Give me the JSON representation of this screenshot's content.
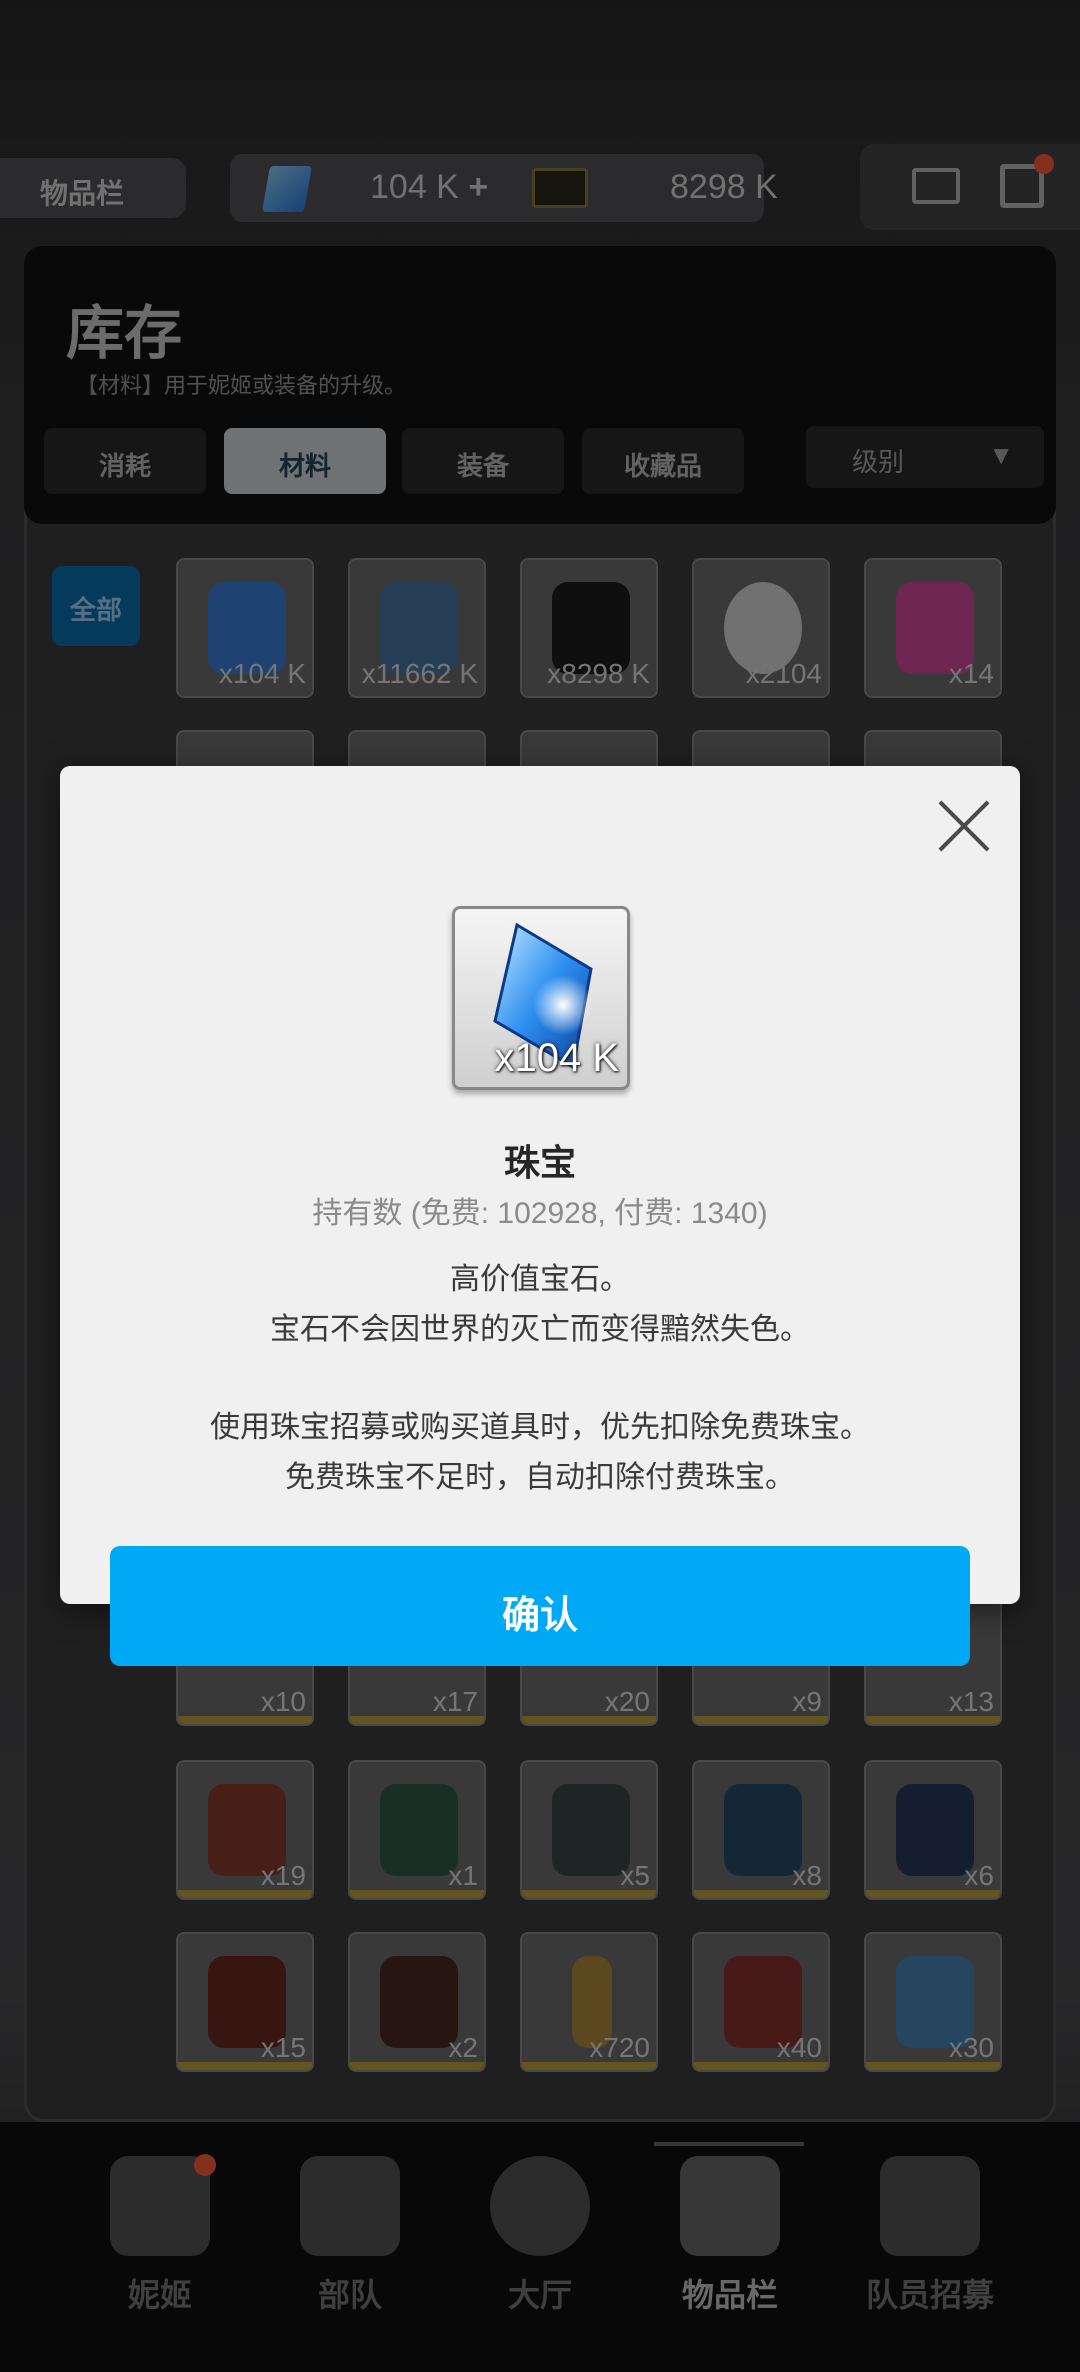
{
  "topbar": {
    "inventory_tag": "物品栏",
    "gems": "104 K",
    "plus": "+",
    "credits": "8298 K"
  },
  "inventory": {
    "title": "库存",
    "subtitle": "【材料】用于妮姬或装备的升级。",
    "tabs": [
      {
        "label": "消耗"
      },
      {
        "label": "材料"
      },
      {
        "label": "装备"
      },
      {
        "label": "收藏品"
      }
    ],
    "sort_label": "级别",
    "sort_arrow": "▼",
    "filter_all": "全部",
    "row1_counts": [
      "x104 K",
      "x11662 K",
      "x8298 K",
      "x2104",
      "x14"
    ],
    "row_a_counts": [
      "x10",
      "x17",
      "x20",
      "x9",
      "x13"
    ],
    "row_b_counts": [
      "x19",
      "x1",
      "x5",
      "x8",
      "x6"
    ],
    "row_c_counts": [
      "x15",
      "x2",
      "x720",
      "x40",
      "x30"
    ]
  },
  "nav": {
    "items": [
      {
        "label": "妮姬"
      },
      {
        "label": "部队"
      },
      {
        "label": "大厅"
      },
      {
        "label": "物品栏"
      },
      {
        "label": "队员招募"
      }
    ]
  },
  "modal": {
    "item_count": "x104 K",
    "item_name": "珠宝",
    "holding": "持有数 (免费: 102928, 付费: 1340)",
    "desc_line1": "高价值宝石。",
    "desc_line2": "宝石不会因世界的灭亡而变得黯然失色。",
    "desc_line3": "使用珠宝招募或购买道具时，优先扣除免费珠宝。",
    "desc_line4": "免费珠宝不足时，自动扣除付费珠宝。",
    "confirm_label": "确认"
  },
  "colors": {
    "confirm_blue": "#00a9f5",
    "active_tab": "#d7dde0",
    "red_dot": "#ff5a3c"
  }
}
